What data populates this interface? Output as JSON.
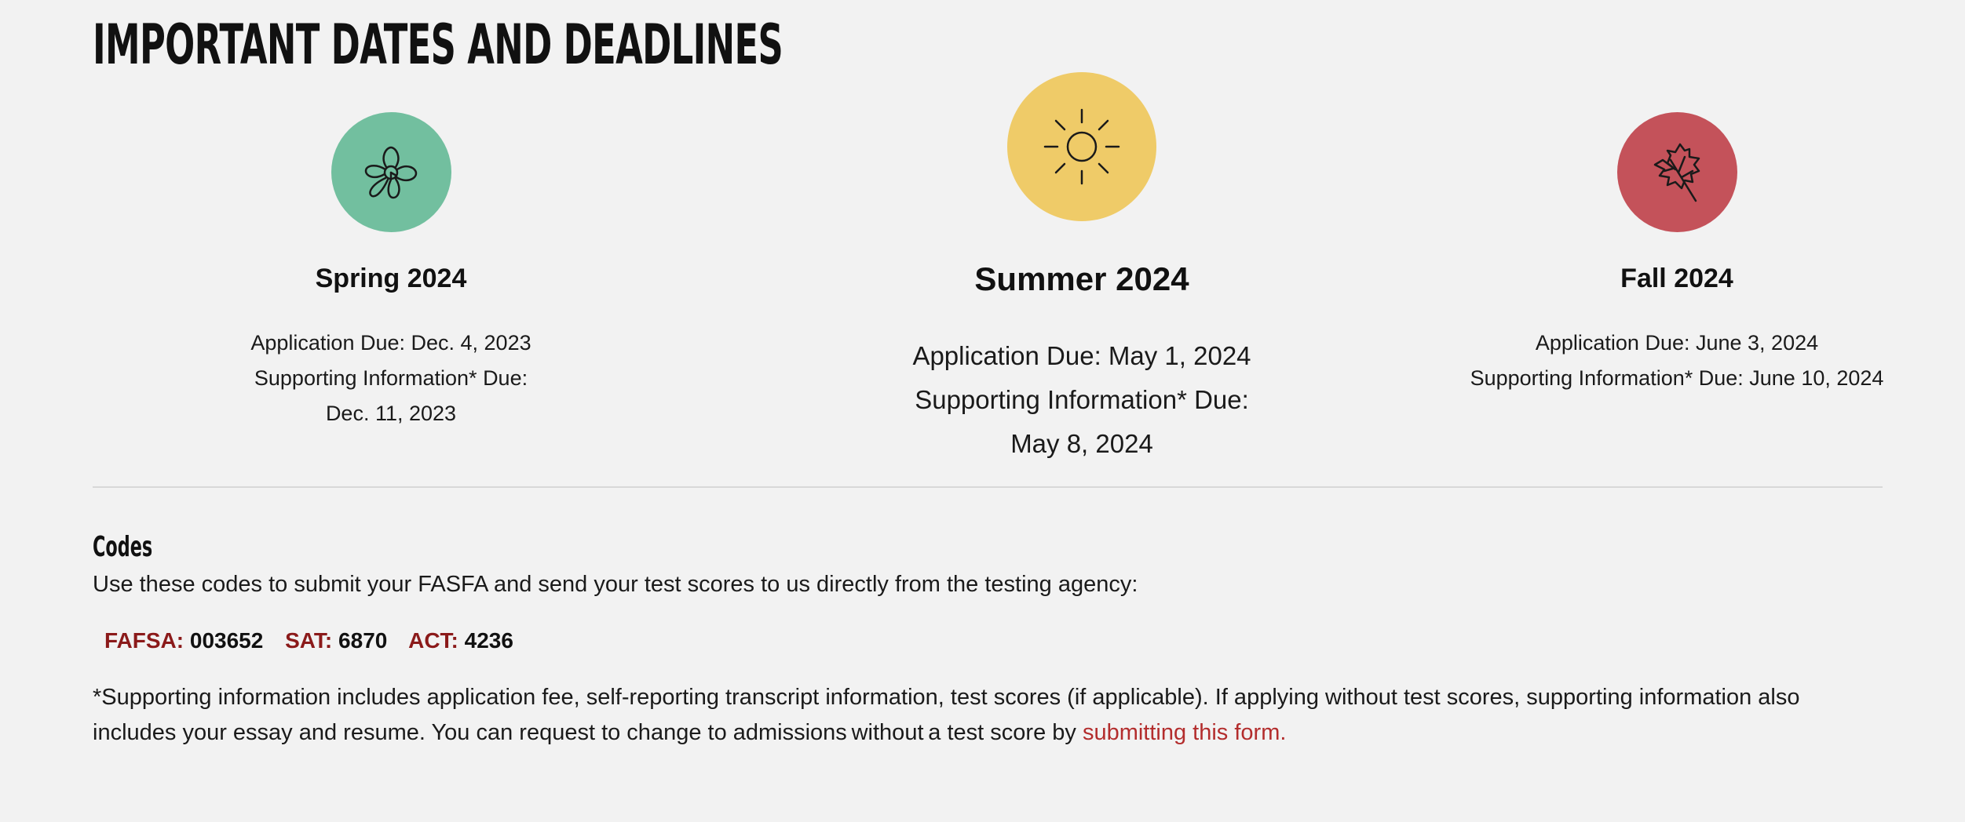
{
  "header": {
    "title": "IMPORTANT DATES AND DEADLINES"
  },
  "seasons": [
    {
      "name": "Spring 2024",
      "icon": "flower-icon",
      "color": "#72bf9f",
      "lines": [
        "Application Due: Dec. 4, 2023",
        "Supporting Information* Due:",
        "Dec. 11, 2023"
      ]
    },
    {
      "name": "Summer 2024",
      "icon": "sun-icon",
      "color": "#efcb68",
      "lines": [
        "Application Due: May 1, 2024",
        "Supporting Information* Due:",
        "May 8, 2024"
      ]
    },
    {
      "name": "Fall 2024",
      "icon": "leaf-icon",
      "color": "#c4525a",
      "lines": [
        "Application Due: June 3, 2024",
        "Supporting Information* Due: June 10, 2024"
      ]
    }
  ],
  "codes": {
    "title": "Codes",
    "intro": "Use these codes to submit your FASFA and send your test scores to us directly from the testing agency:",
    "items": [
      {
        "label": "FAFSA:",
        "value": "003652"
      },
      {
        "label": "SAT:",
        "value": "6870"
      },
      {
        "label": "ACT:",
        "value": "4236"
      }
    ],
    "label_color": "#8b1a1a"
  },
  "footnote": {
    "text": "*Supporting information includes application fee, self-reporting transcript information, test scores (if applicable). If applying without test scores, supporting information also includes your essay and resume. You can request to change to admissions without a test score by ",
    "link_text": "submitting this form.",
    "link_color": "#b32d2d"
  }
}
